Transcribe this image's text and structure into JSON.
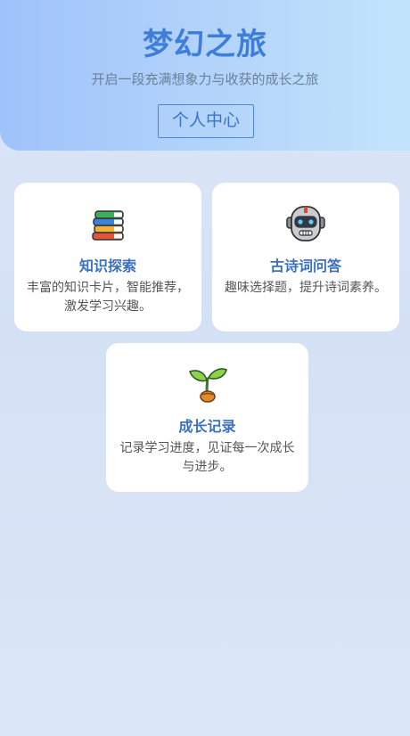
{
  "header": {
    "title": "梦幻之旅",
    "subtitle": "开启一段充满想象力与收获的成长之旅",
    "profile_button": "个人中心"
  },
  "cards": [
    {
      "icon": "books-icon",
      "title": "知识探索",
      "description": "丰富的知识卡片，智能推荐，激发学习兴趣。"
    },
    {
      "icon": "robot-icon",
      "title": "古诗词问答",
      "description": "趣味选择题，提升诗词素养。"
    },
    {
      "icon": "seedling-icon",
      "title": "成长记录",
      "description": "记录学习进度，见证每一次成长与进步。"
    }
  ],
  "colors": {
    "accent": "#3f7ed8",
    "hero_start": "#9fc2fb",
    "hero_end": "#c2e4fb",
    "card_title": "#3a70c0"
  }
}
